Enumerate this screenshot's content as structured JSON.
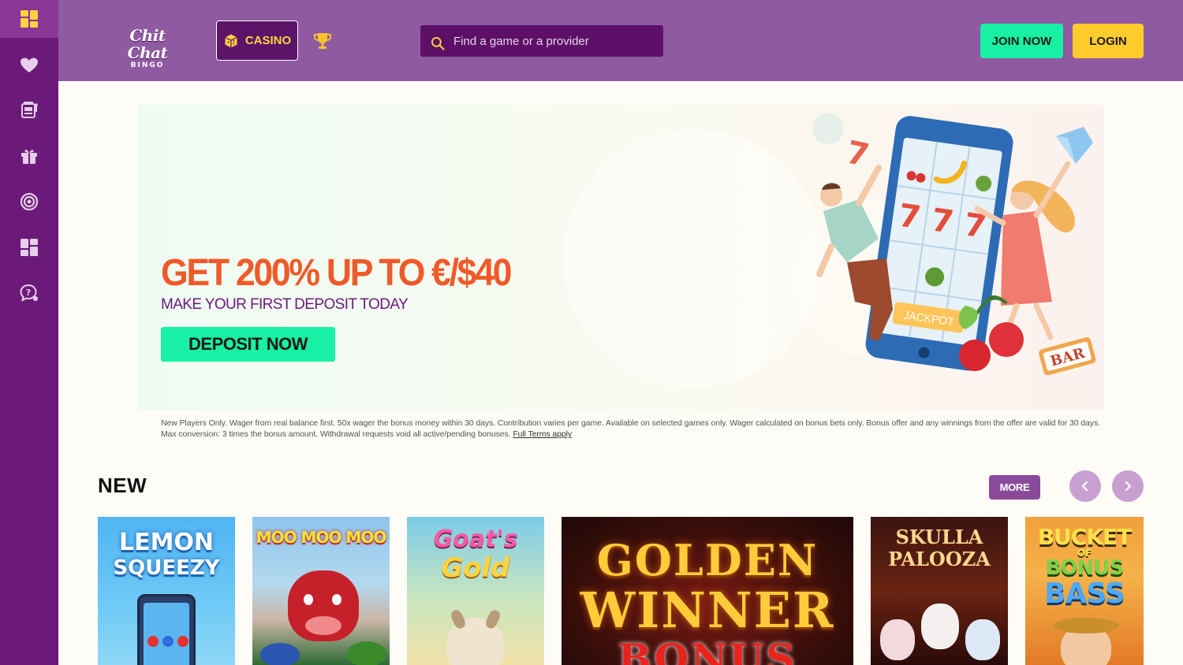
{
  "sidebar": {
    "items": [
      {
        "icon": "grid-icon",
        "active": true
      },
      {
        "icon": "heart-icon"
      },
      {
        "icon": "slot-machine-icon"
      },
      {
        "icon": "gift-icon"
      },
      {
        "icon": "target-icon"
      },
      {
        "icon": "apps-icon"
      },
      {
        "icon": "help-chat-icon"
      }
    ]
  },
  "header": {
    "logo_line1": "Chit Chat",
    "logo_line2": "BINGO",
    "casino_label": "CASINO",
    "search_placeholder": "Find a game or a provider",
    "join_label": "JOIN NOW",
    "login_label": "LOGIN"
  },
  "banner": {
    "headline": "GET 200% UP TO €/$40",
    "subline": "MAKE YOUR FIRST DEPOSIT TODAY",
    "cta": "DEPOSIT NOW",
    "jackpot_label": "JACKPOT",
    "bar_label": "BAR"
  },
  "terms": {
    "text": "New Players Only. Wager from real balance first. 50x wager the bonus money within 30 days. Contribution varies per game. Available on selected games only. Wager calculated on bonus bets only. Bonus offer and any winnings from the offer are valid for 30 days. Max conversion: 3 times the bonus amount. Withdrawal requests void all active/pending bonuses.",
    "link": "Full Terms apply"
  },
  "new_section": {
    "title": "NEW",
    "more_label": "MORE",
    "games": [
      {
        "name_line1": "LEMON",
        "name_line2": "SQUEEZY"
      },
      {
        "name_line1": "MOO MOO MOO",
        "name_line2": ""
      },
      {
        "name_line1": "Goat's",
        "name_line2": "Gold"
      },
      {
        "name_line1": "GOLDEN",
        "name_line2": "WINNER",
        "name_line3": "BONUS"
      },
      {
        "name_line1": "SKULLA",
        "name_line2": "PALOOZA"
      },
      {
        "name_line1": "BUCKET",
        "name_line2": "OF",
        "name_line3": "BONUS",
        "name_line4": "BASS"
      }
    ]
  },
  "colors": {
    "sidebar": "#6b1a7a",
    "header": "#8f5aa1",
    "accent_green": "#18f0a5",
    "accent_yellow": "#ffcb2d",
    "headline_orange": "#f05a28"
  }
}
